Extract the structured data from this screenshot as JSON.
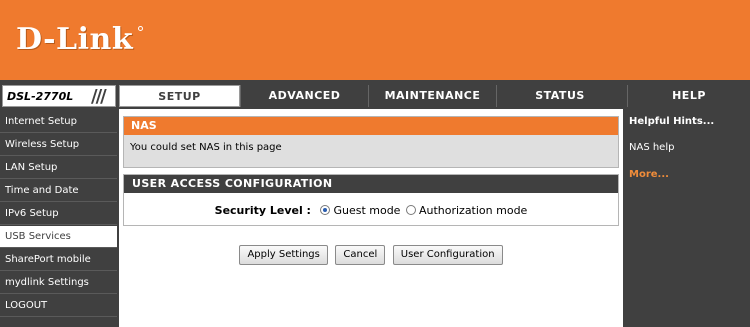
{
  "brand": {
    "logo": "D-Link"
  },
  "model": "DSL-2770L",
  "tabs": [
    {
      "label": "SETUP",
      "active": true
    },
    {
      "label": "ADVANCED",
      "active": false
    },
    {
      "label": "MAINTENANCE",
      "active": false
    },
    {
      "label": "STATUS",
      "active": false
    }
  ],
  "help_tab": "HELP",
  "sidebar": {
    "items": [
      {
        "label": "Internet Setup"
      },
      {
        "label": "Wireless Setup"
      },
      {
        "label": "LAN Setup"
      },
      {
        "label": "Time and Date"
      },
      {
        "label": "IPv6 Setup"
      },
      {
        "label": "USB Services",
        "active": true
      },
      {
        "label": "SharePort mobile"
      },
      {
        "label": "mydlink Settings"
      },
      {
        "label": "LOGOUT"
      }
    ]
  },
  "nas": {
    "title": "NAS",
    "description": "You could set NAS in this page"
  },
  "uac": {
    "title": "USER ACCESS CONFIGURATION",
    "security_label": "Security Level :",
    "options": [
      {
        "label": "Guest mode",
        "selected": true
      },
      {
        "label": "Authorization mode",
        "selected": false
      }
    ]
  },
  "buttons": {
    "apply": "Apply Settings",
    "cancel": "Cancel",
    "user_config": "User Configuration"
  },
  "help": {
    "title": "Helpful Hints...",
    "link": "NAS help",
    "more": "More..."
  },
  "colors": {
    "brand_orange": "#ef7a2e",
    "dark": "#404040"
  }
}
